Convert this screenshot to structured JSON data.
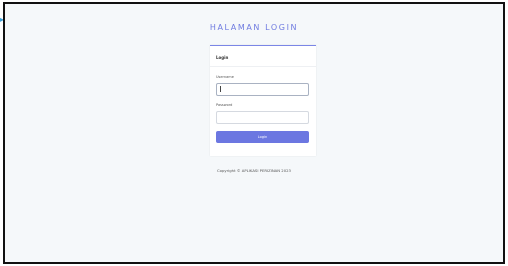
{
  "header": {
    "title": "HALAMAN LOGIN"
  },
  "card": {
    "title": "Login",
    "username_label": "Username",
    "username_value": "",
    "password_label": "Password",
    "password_value": "",
    "submit_label": "Login"
  },
  "footer": {
    "copyright": "Copyright © APLIKASI PERIZINAN 2023"
  },
  "colors": {
    "accent": "#6c77e1",
    "background": "#f5f8fa"
  }
}
